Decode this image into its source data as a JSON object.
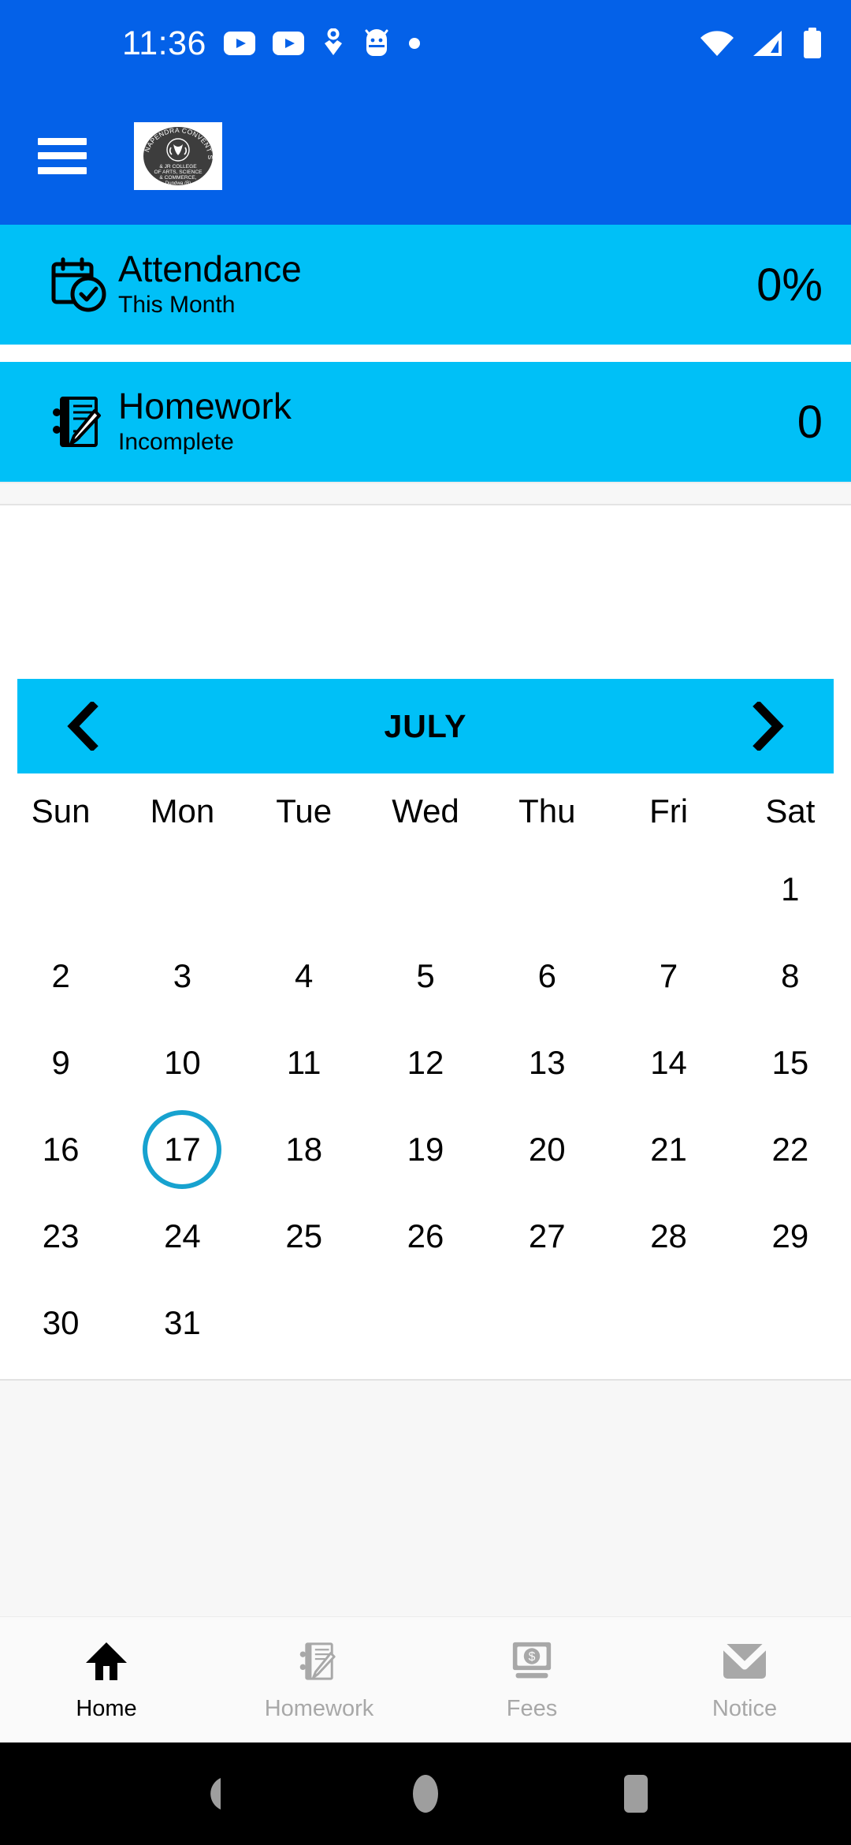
{
  "status_bar": {
    "time": "11:36",
    "left_icons": [
      "youtube-icon",
      "youtube-icon",
      "location-heart-icon",
      "android-head-icon",
      "dot-icon"
    ],
    "right_icons": [
      "wifi-icon",
      "signal-icon",
      "battery-icon"
    ],
    "background_color": "#0461E8"
  },
  "app_bar": {
    "menu_label": "menu",
    "logo_alt": "NAPENDRA CONVENT SCHOOL & JR COLLEGE OF ARTS, SCIENCE & COMMERCE, Dundwa (B)",
    "background_color": "#0461E8"
  },
  "cards": [
    {
      "id": "attendance",
      "icon": "calendar-check-icon",
      "title": "Attendance",
      "subtitle": "This Month",
      "value": "0%",
      "background_color": "#00C0F7"
    },
    {
      "id": "homework",
      "icon": "notebook-pencil-icon",
      "title": "Homework",
      "subtitle": "Incomplete",
      "value": "0",
      "background_color": "#00C0F7"
    }
  ],
  "calendar": {
    "month": "JULY",
    "prev_label": "previous month",
    "next_label": "next month",
    "header_color": "#00C0F7",
    "selected_color": "#17A2CF",
    "weekdays": [
      "Sun",
      "Mon",
      "Tue",
      "Wed",
      "Thu",
      "Fri",
      "Sat"
    ],
    "leading_blanks": 6,
    "days": [
      1,
      2,
      3,
      4,
      5,
      6,
      7,
      8,
      9,
      10,
      11,
      12,
      13,
      14,
      15,
      16,
      17,
      18,
      19,
      20,
      21,
      22,
      23,
      24,
      25,
      26,
      27,
      28,
      29,
      30,
      31
    ],
    "selected_day": 17,
    "trailing_blanks": 5
  },
  "bottom_nav": {
    "items": [
      {
        "label": "Home",
        "icon": "home-icon",
        "active": true
      },
      {
        "label": "Homework",
        "icon": "notebook-pencil-icon",
        "active": false
      },
      {
        "label": "Fees",
        "icon": "money-bill-icon",
        "active": false
      },
      {
        "label": "Notice",
        "icon": "envelope-icon",
        "active": false
      }
    ],
    "active_color": "#000000",
    "inactive_color": "#a8a8a8"
  },
  "android_nav": {
    "items": [
      "back-button",
      "home-button",
      "recents-button"
    ],
    "background_color": "#000000",
    "icon_color": "#9e9e9e"
  }
}
